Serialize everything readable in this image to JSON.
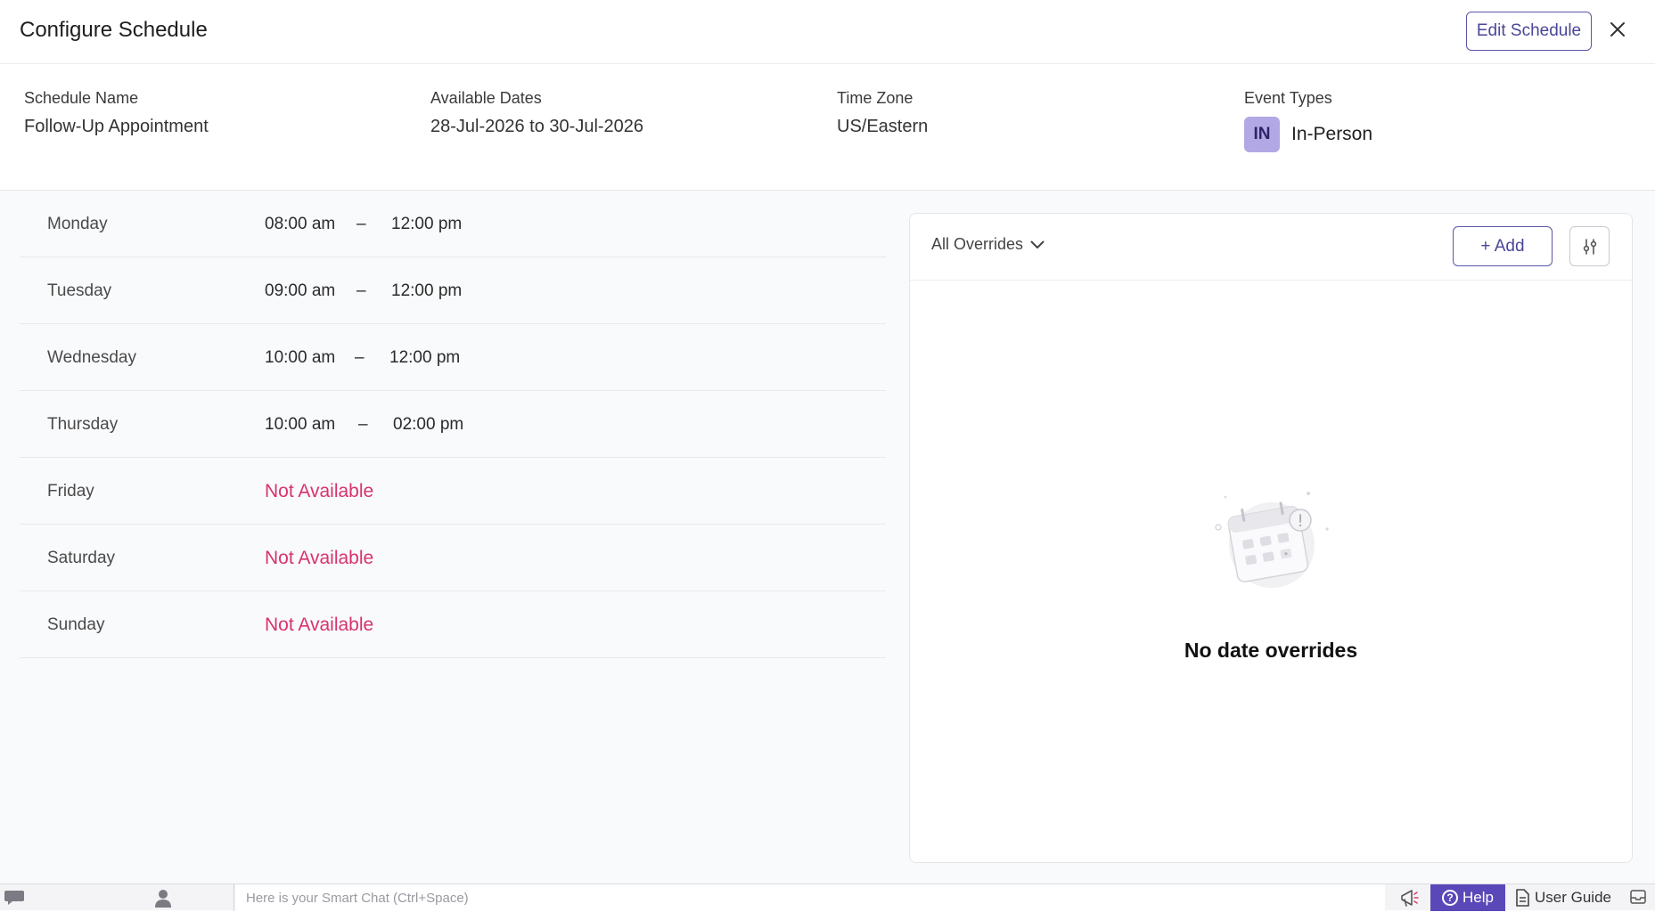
{
  "header": {
    "title": "Configure Schedule",
    "edit_label": "Edit Schedule"
  },
  "info": {
    "schedule_name_label": "Schedule Name",
    "schedule_name_value": "Follow-Up Appointment",
    "dates_label": "Available Dates",
    "dates_value": "28-Jul-2026 to 30-Jul-2026",
    "timezone_label": "Time Zone",
    "timezone_value": "US/Eastern",
    "event_types_label": "Event Types",
    "event_badge": "IN",
    "event_name": "In-Person"
  },
  "schedule": {
    "days": [
      {
        "day": "Monday",
        "start": "08:00 am",
        "dash": "–",
        "end": "12:00 pm"
      },
      {
        "day": "Tuesday",
        "start": "09:00 am",
        "dash": "–",
        "end": "12:00 pm"
      },
      {
        "day": "Wednesday",
        "start": "10:00 am",
        "dash": "–",
        "end": "12:00 pm"
      },
      {
        "day": "Thursday",
        "start": "10:00 am",
        "dash": "–",
        "end": "02:00 pm"
      },
      {
        "day": "Friday",
        "status": "Not Available"
      },
      {
        "day": "Saturday",
        "status": "Not Available"
      },
      {
        "day": "Sunday",
        "status": "Not Available"
      }
    ]
  },
  "overrides": {
    "filter_label": "All Overrides",
    "add_label": "+ Add",
    "empty_text": "No date overrides"
  },
  "footer": {
    "chat_placeholder": "Here is your Smart Chat (Ctrl+Space)",
    "help_label": "Help",
    "guide_label": "User Guide"
  },
  "colors": {
    "accent": "#5a48b8",
    "unavailable": "#d8336b",
    "badge": "#b3a8e6"
  }
}
